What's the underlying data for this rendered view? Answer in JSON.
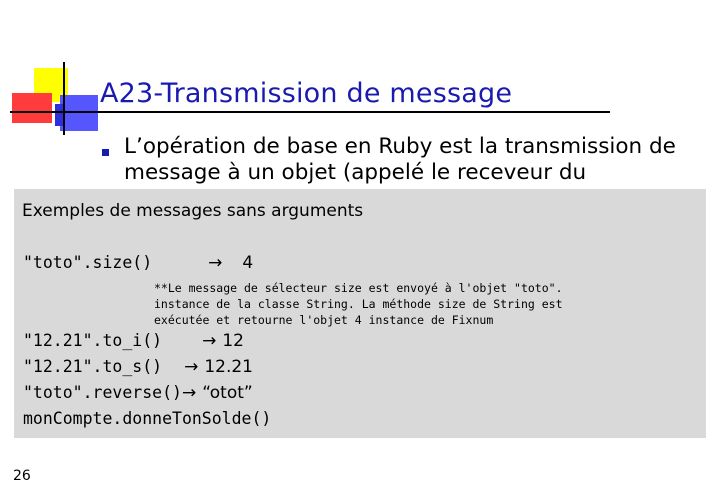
{
  "slide": {
    "title": "A23-Transmission de message",
    "bullet_text": "L’opération de base en Ruby est la transmission de message à un objet (appelé le receveur du",
    "page_number": "26"
  },
  "panel": {
    "heading": "Exemples de messages sans arguments",
    "lines": [
      {
        "code": "\"toto\".size()",
        "result": "4"
      },
      {
        "code": "\"12.21\".to_i()",
        "result": "12"
      },
      {
        "code": "\"12.21\".to_s()",
        "result": "12.21"
      },
      {
        "code": "\"toto\".reverse()",
        "result": "“otot”"
      },
      {
        "code": "monCompte.donneTonSolde()",
        "result": ""
      }
    ],
    "note_lines": [
      "**Le message de sélecteur size est envoyé à l'objet \"toto\".",
      "instance de la classe String. La méthode size de String est",
      "exécutée et retourne l'objet 4 instance de Fixnum"
    ],
    "arrow_glyph": "→"
  },
  "colors": {
    "title": "#1a1ab0",
    "panel_background": "#d9d9d9",
    "logo_yellow": "#ffff00",
    "logo_red": "#ff3b3b",
    "logo_blue": "#5656ff"
  }
}
